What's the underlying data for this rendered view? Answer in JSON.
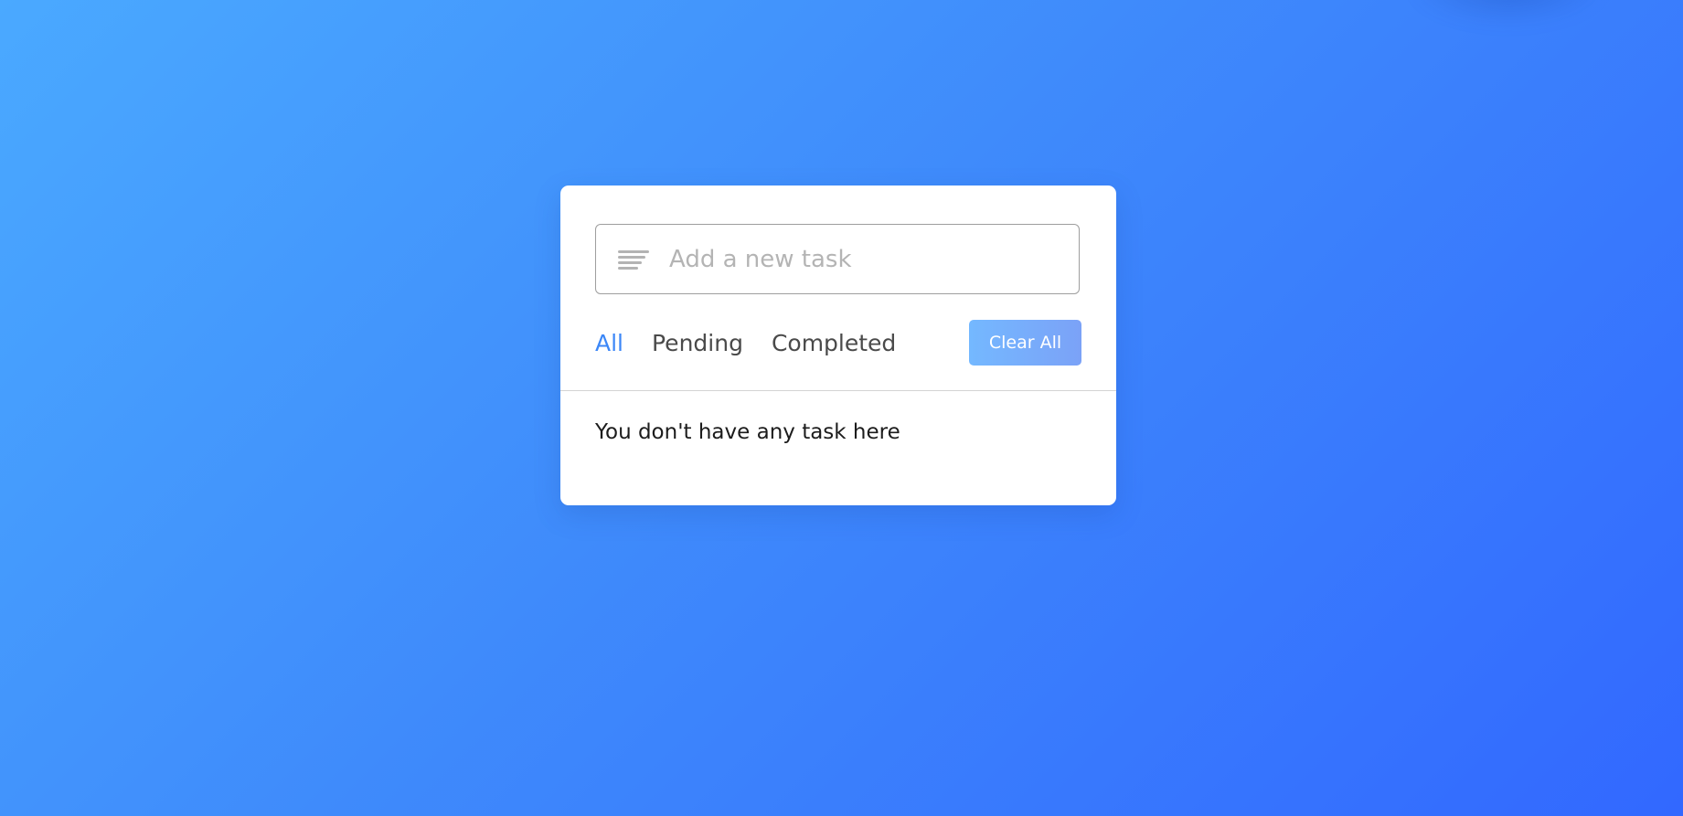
{
  "task_input": {
    "placeholder": "Add a new task",
    "value": "",
    "icon": "menu-lines-icon"
  },
  "filters": [
    {
      "label": "All",
      "active": true
    },
    {
      "label": "Pending",
      "active": false
    },
    {
      "label": "Completed",
      "active": false
    }
  ],
  "clear_button": {
    "label": "Clear All"
  },
  "task_list": {
    "empty_message": "You don't have any task here"
  },
  "colors": {
    "background_start": "#4aa9ff",
    "background_end": "#3268ff",
    "accent": "#3c87f7",
    "button_start": "#74b8ff",
    "button_end": "#7ba2f7"
  }
}
